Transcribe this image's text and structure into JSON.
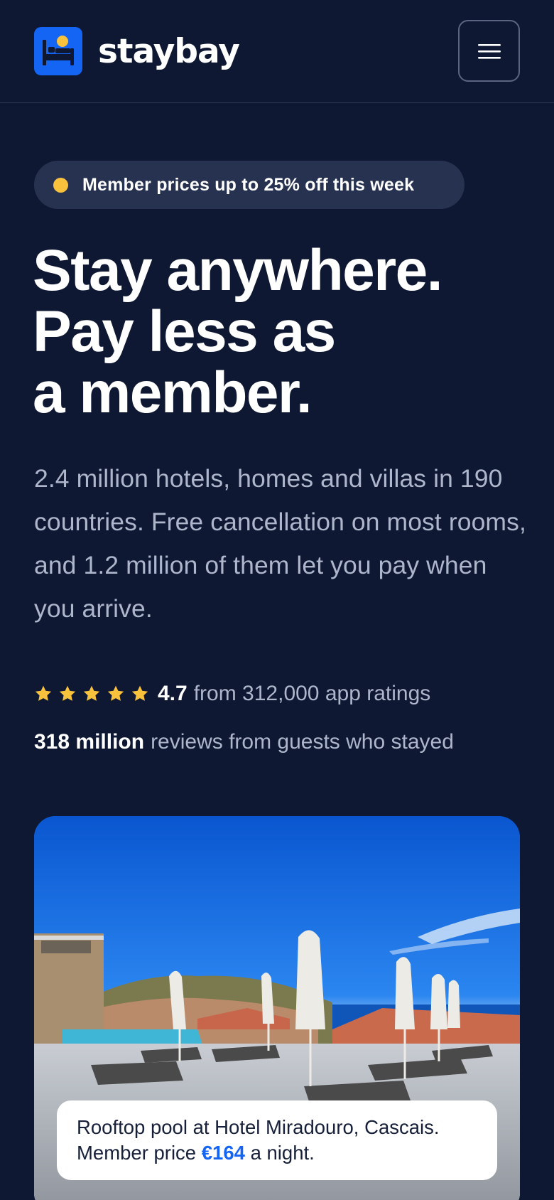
{
  "brand": {
    "name": "staybay"
  },
  "header": {
    "menu_icon": "hamburger-menu-icon"
  },
  "promo": {
    "text": "Member prices up to 25% off this week",
    "dot_color": "#f9c23c"
  },
  "hero": {
    "heading_line1": "Stay anywhere.",
    "heading_line2": "Pay less as",
    "heading_line3": "a member.",
    "description": "2.4 million hotels, homes and villas in 190 countries. Free cancellation on most rooms, and 1.2 million of them let you pay when you arrive."
  },
  "rating": {
    "stars": 5,
    "score": "4.7",
    "text": "from 312,000 app ratings",
    "star_color": "#f9c23c"
  },
  "reviews": {
    "count": "318 million",
    "text": "reviews from guests who stayed"
  },
  "photo": {
    "caption_line1": "Rooftop pool at Hotel Miradouro, Cascais.",
    "caption_prefix": "Member price",
    "price": "€164",
    "caption_suffix": "a night."
  },
  "colors": {
    "background": "#0e1833",
    "accent": "#1565f4",
    "muted_text": "#aeb6cb"
  }
}
